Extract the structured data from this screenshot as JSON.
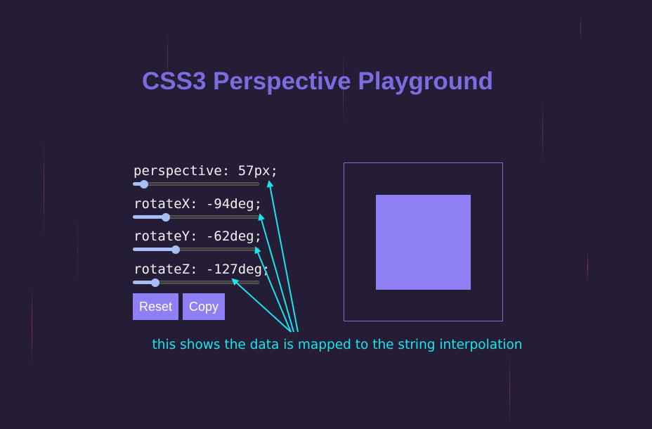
{
  "title": "CSS3 Perspective Playground",
  "controls": [
    {
      "label": "perspective: 57px;",
      "level": 0.09
    },
    {
      "label": "rotateX: -94deg;",
      "level": 0.26
    },
    {
      "label": "rotateY: -62deg;",
      "level": 0.34
    },
    {
      "label": "rotateZ: -127deg;",
      "level": 0.18
    }
  ],
  "buttons": {
    "reset_label": "Reset",
    "copy_label": "Copy"
  },
  "annotation": {
    "text": "this shows the data is mapped to the string interpolation"
  },
  "colors": {
    "background": "#251c36",
    "accent": "#8f7ff4",
    "title": "#7d6be0",
    "annotation": "#17e6ef",
    "slider_fill": "#a8bff5"
  }
}
